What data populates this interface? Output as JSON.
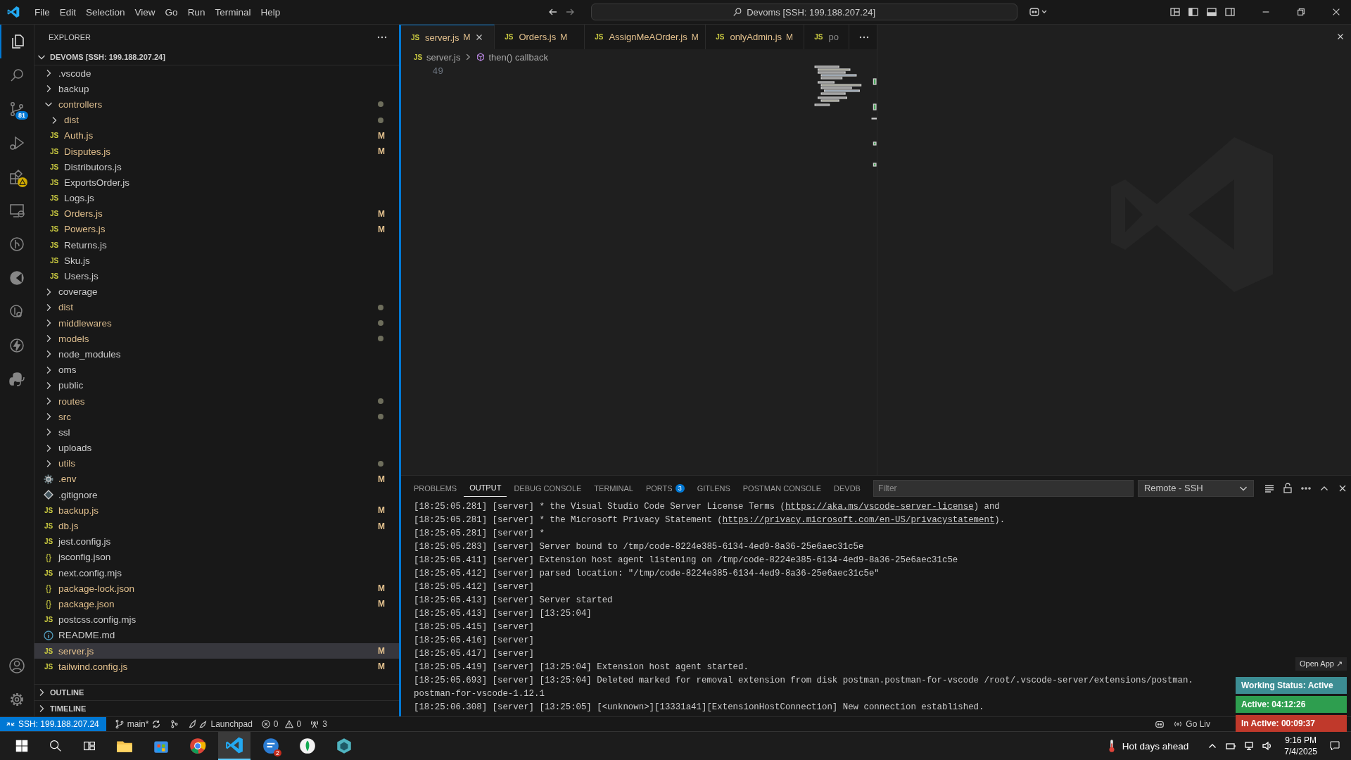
{
  "menu": [
    "File",
    "Edit",
    "Selection",
    "View",
    "Go",
    "Run",
    "Terminal",
    "Help"
  ],
  "command_center": "Devoms [SSH: 199.188.207.24]",
  "activity": [
    {
      "kind": "files",
      "selected": true
    },
    {
      "kind": "search",
      "selected": false
    },
    {
      "kind": "branch",
      "selected": false,
      "badge": "81"
    },
    {
      "kind": "debug",
      "selected": false
    },
    {
      "kind": "extensions",
      "selected": false,
      "alert": true
    },
    {
      "kind": "remote",
      "selected": false
    },
    {
      "kind": "graph",
      "selected": false
    },
    {
      "kind": "pie",
      "selected": false
    },
    {
      "kind": "inspect",
      "selected": false
    },
    {
      "kind": "bolt",
      "selected": false
    },
    {
      "kind": "python",
      "selected": false
    }
  ],
  "activity_bottom": [
    {
      "kind": "account"
    },
    {
      "kind": "gear"
    }
  ],
  "explorer": {
    "title": "EXPLORER",
    "root": "DEVOMS [SSH: 199.188.207.24]",
    "items": [
      {
        "name": ".vscode",
        "kind": "folder",
        "expanded": false,
        "selected": false
      },
      {
        "name": "backup",
        "kind": "folder",
        "expanded": false,
        "selected": false
      },
      {
        "name": "controllers",
        "kind": "folder",
        "expanded": true,
        "selected": false,
        "dot": true,
        "children": [
          {
            "name": "dist",
            "kind": "folder",
            "expanded": false,
            "selected": false,
            "dot": true
          },
          {
            "name": "Auth.js",
            "kind": "js",
            "icon": "JS",
            "badge": "M",
            "selected": false
          },
          {
            "name": "Disputes.js",
            "kind": "js",
            "icon": "JS",
            "badge": "M",
            "selected": false
          },
          {
            "name": "Distributors.js",
            "kind": "js",
            "icon": "JS",
            "selected": false
          },
          {
            "name": "ExportsOrder.js",
            "kind": "js",
            "icon": "JS",
            "selected": false
          },
          {
            "name": "Logs.js",
            "kind": "js",
            "icon": "JS",
            "selected": false
          },
          {
            "name": "Orders.js",
            "kind": "js",
            "icon": "JS",
            "badge": "M",
            "selected": false
          },
          {
            "name": "Powers.js",
            "kind": "js",
            "icon": "JS",
            "badge": "M",
            "selected": false
          },
          {
            "name": "Returns.js",
            "kind": "js",
            "icon": "JS",
            "selected": false
          },
          {
            "name": "Sku.js",
            "kind": "js",
            "icon": "JS",
            "selected": false
          },
          {
            "name": "Users.js",
            "kind": "js",
            "icon": "JS",
            "selected": false
          }
        ]
      },
      {
        "name": "coverage",
        "kind": "folder",
        "expanded": false,
        "selected": false
      },
      {
        "name": "dist",
        "kind": "folder",
        "expanded": false,
        "selected": false,
        "dot": true
      },
      {
        "name": "middlewares",
        "kind": "folder",
        "expanded": false,
        "selected": false,
        "dot": true
      },
      {
        "name": "models",
        "kind": "folder",
        "expanded": false,
        "selected": false,
        "dot": true
      },
      {
        "name": "node_modules",
        "kind": "folder",
        "expanded": false,
        "selected": false
      },
      {
        "name": "oms",
        "kind": "folder",
        "expanded": false,
        "selected": false
      },
      {
        "name": "public",
        "kind": "folder",
        "expanded": false,
        "selected": false
      },
      {
        "name": "routes",
        "kind": "folder",
        "expanded": false,
        "selected": false,
        "dot": true
      },
      {
        "name": "src",
        "kind": "folder",
        "expanded": false,
        "selected": false,
        "dot": true
      },
      {
        "name": "ssl",
        "kind": "folder",
        "expanded": false,
        "selected": false
      },
      {
        "name": "uploads",
        "kind": "folder",
        "expanded": false,
        "selected": false
      },
      {
        "name": "utils",
        "kind": "folder",
        "expanded": false,
        "selected": false,
        "dot": true
      },
      {
        "name": ".env",
        "kind": "env",
        "badge": "M",
        "selected": false
      },
      {
        "name": ".gitignore",
        "kind": "gitignore",
        "selected": false
      },
      {
        "name": "backup.js",
        "kind": "js",
        "icon": "JS",
        "badge": "M",
        "selected": false
      },
      {
        "name": "db.js",
        "kind": "js",
        "icon": "JS",
        "badge": "M",
        "selected": false
      },
      {
        "name": "jest.config.js",
        "kind": "js",
        "icon": "JS",
        "selected": false
      },
      {
        "name": "jsconfig.json",
        "kind": "json",
        "icon": "{}",
        "selected": false
      },
      {
        "name": "next.config.mjs",
        "kind": "js",
        "icon": "JS",
        "selected": false
      },
      {
        "name": "package-lock.json",
        "kind": "json",
        "icon": "{}",
        "badge": "M",
        "selected": false
      },
      {
        "name": "package.json",
        "kind": "json",
        "icon": "{}",
        "badge": "M",
        "selected": false
      },
      {
        "name": "postcss.config.mjs",
        "kind": "js",
        "icon": "JS",
        "selected": false
      },
      {
        "name": "README.md",
        "kind": "info",
        "selected": false
      },
      {
        "name": "server.js",
        "kind": "js",
        "icon": "JS",
        "badge": "M",
        "selected": true
      },
      {
        "name": "tailwind.config.js",
        "kind": "js",
        "icon": "JS",
        "badge": "M",
        "selected": false
      }
    ],
    "sections": [
      {
        "title": "OUTLINE",
        "expanded": false
      },
      {
        "title": "TIMELINE",
        "expanded": false
      }
    ]
  },
  "tabs": [
    {
      "icon": "JS",
      "label": "server.js",
      "badge": "M",
      "selected": true
    },
    {
      "icon": "JS",
      "label": "Orders.js",
      "badge": "M",
      "selected": false
    },
    {
      "icon": "JS",
      "label": "AssignMeAOrder.js",
      "badge": "M",
      "selected": false
    },
    {
      "icon": "JS",
      "label": "onlyAdmin.js",
      "badge": "M",
      "selected": false
    },
    {
      "icon": "JS",
      "label": "po",
      "selected": false
    }
  ],
  "breadcrumb": {
    "file_icon": "JS",
    "file": "server.js",
    "symbol": "then() callback"
  },
  "line_number": "49",
  "panel": {
    "tabs": [
      {
        "label": "PROBLEMS",
        "selected": false
      },
      {
        "label": "OUTPUT",
        "selected": true
      },
      {
        "label": "DEBUG CONSOLE",
        "selected": false
      },
      {
        "label": "TERMINAL",
        "selected": false
      },
      {
        "label": "PORTS",
        "selected": false,
        "badge": "3"
      },
      {
        "label": "GITLENS",
        "selected": false
      },
      {
        "label": "POSTMAN CONSOLE",
        "selected": false
      },
      {
        "label": "DEVDB",
        "selected": false
      }
    ],
    "filter_placeholder": "Filter",
    "channel": "Remote - SSH",
    "lines": [
      {
        "text": "[18:25:05.281] [server] * the Visual Studio Code Server License Terms (",
        "link": "https://aka.ms/vscode-server-license",
        "after": ") and"
      },
      {
        "text": "[18:25:05.281] [server] * the Microsoft Privacy Statement (",
        "link": "https://privacy.microsoft.com/en-US/privacystatement",
        "after": ")."
      },
      {
        "text": "[18:25:05.281] [server] *"
      },
      {
        "text": "[18:25:05.283] [server] Server bound to /tmp/code-8224e385-6134-4ed9-8a36-25e6aec31c5e"
      },
      {
        "text": "[18:25:05.411] [server] Extension host agent listening on /tmp/code-8224e385-6134-4ed9-8a36-25e6aec31c5e"
      },
      {
        "text": "[18:25:05.412] [server] parsed location: \"/tmp/code-8224e385-6134-4ed9-8a36-25e6aec31c5e\""
      },
      {
        "text": "[18:25:05.412] [server]"
      },
      {
        "text": "[18:25:05.413] [server] Server started"
      },
      {
        "text": "[18:25:05.413] [server] [13:25:04]"
      },
      {
        "text": "[18:25:05.415] [server]"
      },
      {
        "text": "[18:25:05.416] [server]"
      },
      {
        "text": "[18:25:05.417] [server]"
      },
      {
        "text": "[18:25:05.419] [server] [13:25:04] Extension host agent started."
      },
      {
        "text": "[18:25:05.693] [server] [13:25:04] Deleted marked for removal extension from disk postman.postman-for-vscode /root/.vscode-server/extensions/postman."
      },
      {
        "text": "postman-for-vscode-1.12.1"
      },
      {
        "text": "[18:25:06.308] [server] [13:25:05] [<unknown>][13331a41][ExtensionHostConnection] New connection established."
      }
    ]
  },
  "tracker": {
    "open_label": "Open App ↗",
    "rows": [
      {
        "text": "Working Status: Active",
        "color": "#3c8d93"
      },
      {
        "text": "Active: 04:12:26",
        "color": "#2e9e4f"
      },
      {
        "text": "In Active: 00:09:37",
        "color": "#c0392b"
      }
    ]
  },
  "status_bar": {
    "remote": "SSH: 199.188.207.24",
    "branch": "main*",
    "launchpad": "Launchpad",
    "errors": "0",
    "warnings": "0",
    "ports": "3",
    "go_live": "Go Liv"
  },
  "taskbar": {
    "apps": [
      {
        "kind": "folder",
        "active": false
      },
      {
        "kind": "store",
        "active": false
      },
      {
        "kind": "browser",
        "active": false
      },
      {
        "kind": "editor",
        "active": true
      },
      {
        "kind": "chat",
        "active": false,
        "badge": "2"
      },
      {
        "kind": "leaf",
        "active": false
      },
      {
        "kind": "cube",
        "active": false
      }
    ],
    "weather": "Hot days ahead",
    "time": "9:16 PM",
    "date": "7/4/2025"
  }
}
